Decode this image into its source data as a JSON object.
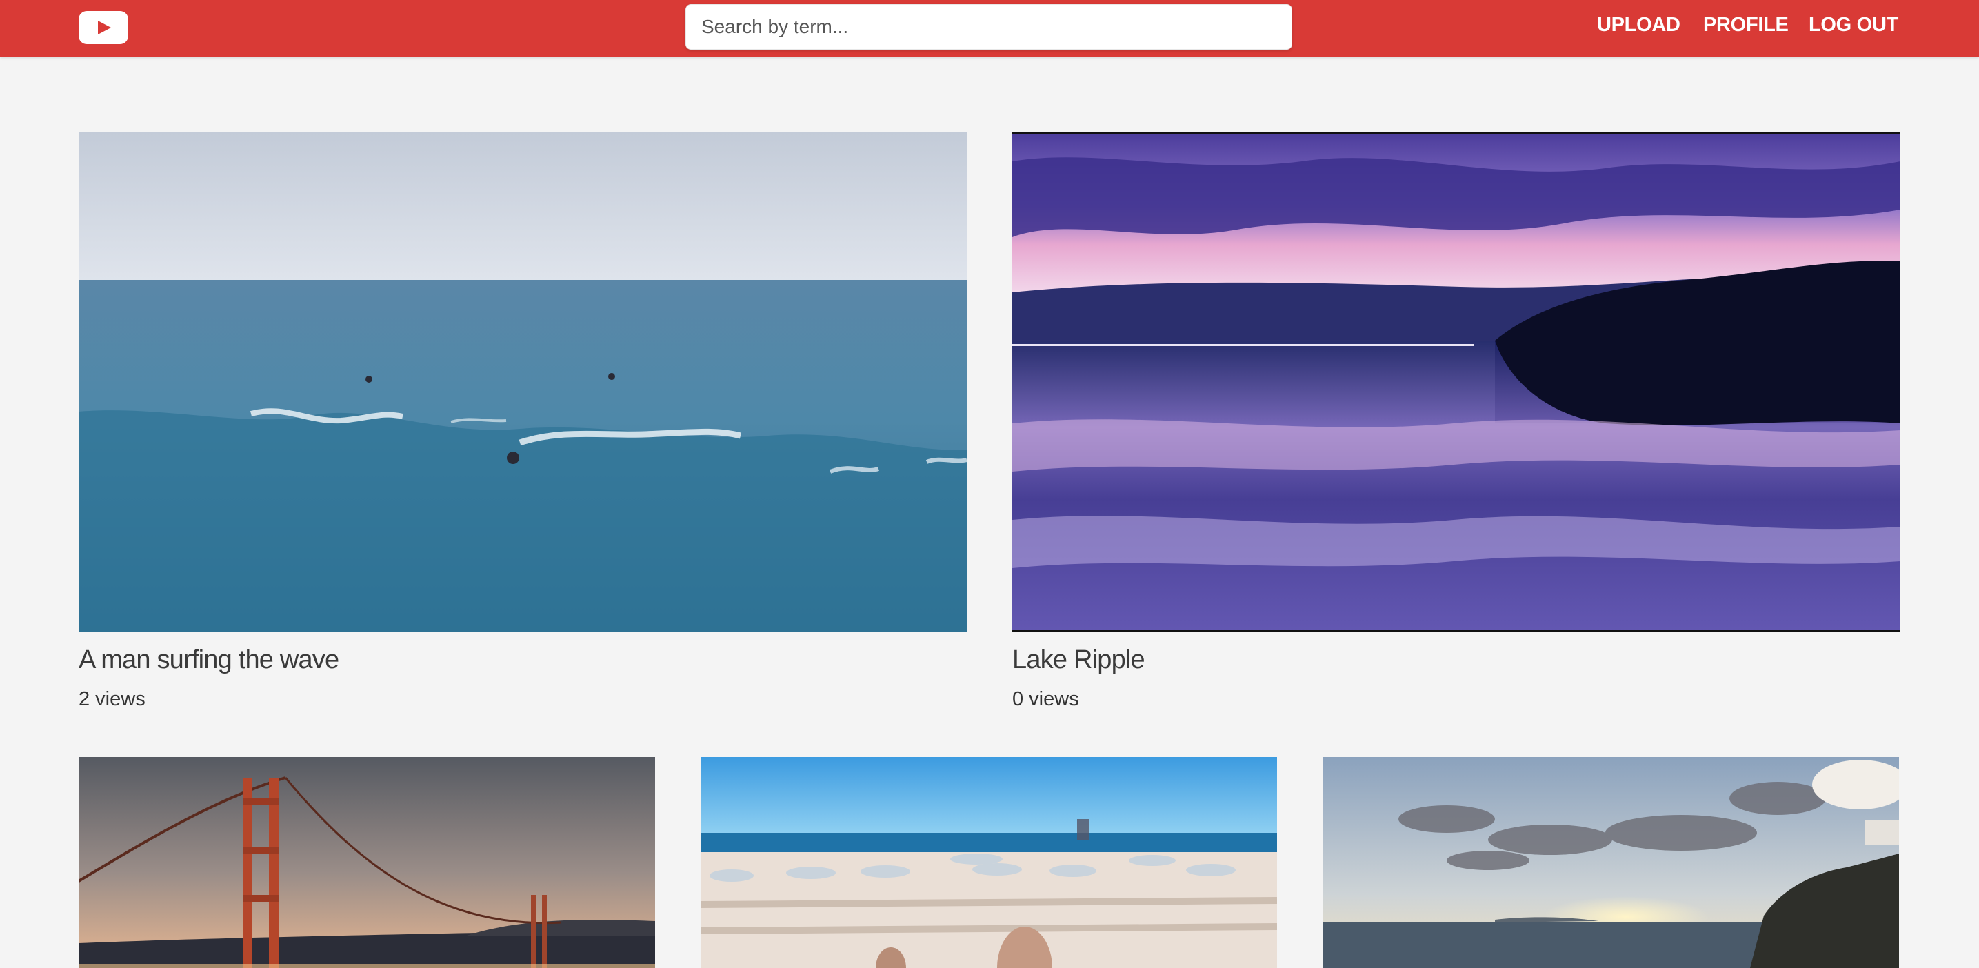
{
  "header": {
    "logo_icon": "play-icon",
    "search": {
      "placeholder": "Search by term...",
      "value": ""
    },
    "nav": {
      "upload": "UPLOAD",
      "profile": "PROFILE",
      "logout": "LOG OUT"
    },
    "brand_color": "#d93a36"
  },
  "videos": [
    {
      "title": "A man surfing the wave",
      "views": "2 views",
      "thumbnail": "surfing-ocean-image"
    },
    {
      "title": "Lake Ripple",
      "views": "0 views",
      "thumbnail": "lake-sunset-reflection-image"
    },
    {
      "title": "",
      "views": "",
      "thumbnail": "golden-gate-bridge-image"
    },
    {
      "title": "",
      "views": "",
      "thumbnail": "beach-loungers-image"
    },
    {
      "title": "",
      "views": "",
      "thumbnail": "coastal-sunset-image"
    }
  ]
}
